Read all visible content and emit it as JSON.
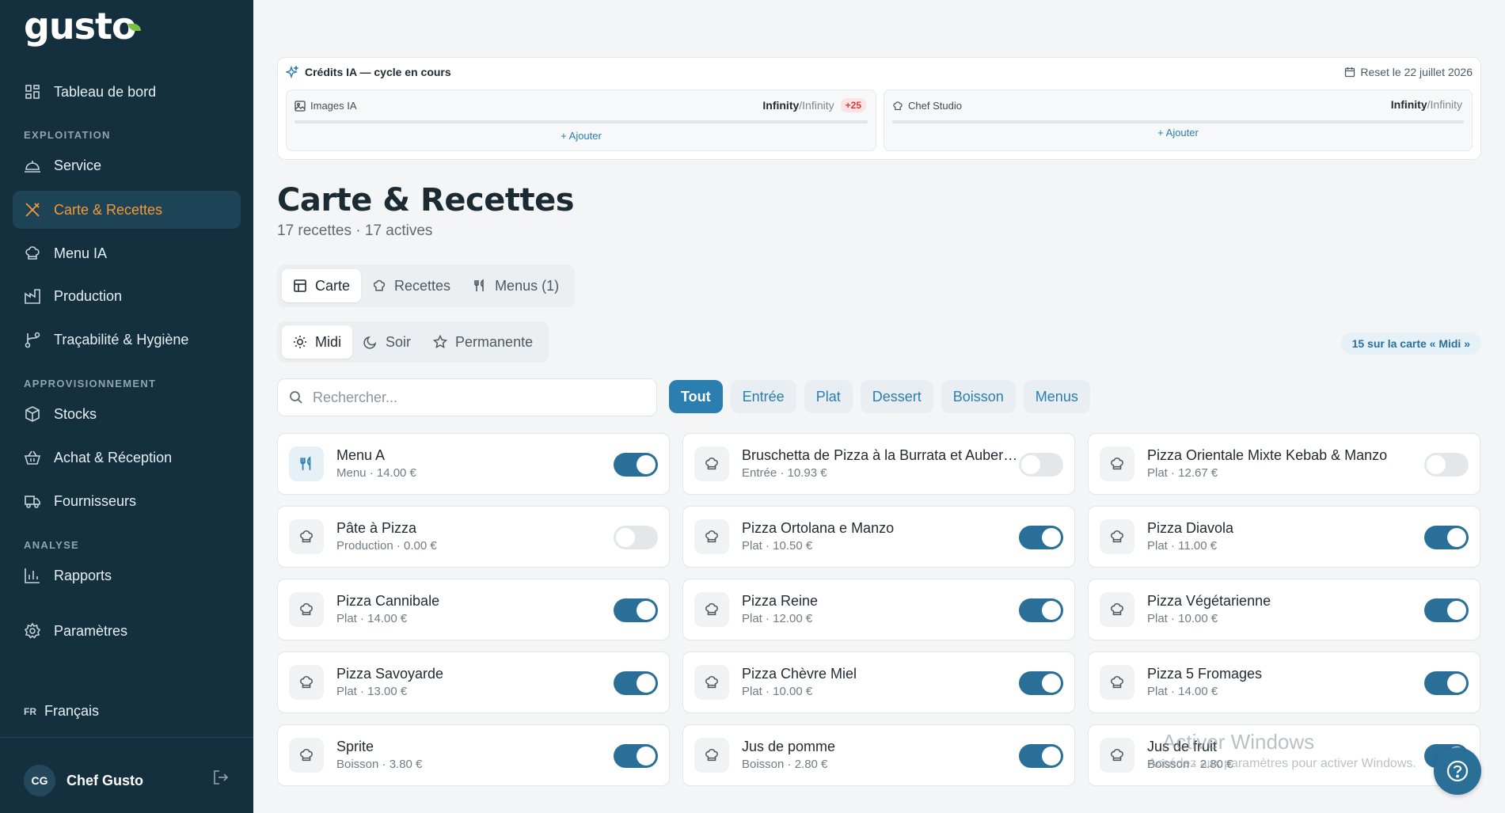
{
  "sidebar": {
    "logo": "gusto",
    "items": {
      "dashboard": "Tableau de bord",
      "service": "Service",
      "carte": "Carte & Recettes",
      "menu_ia": "Menu IA",
      "production": "Production",
      "tracabilite": "Traçabilité & Hygiène",
      "stocks": "Stocks",
      "achat": "Achat & Réception",
      "fournisseurs": "Fournisseurs",
      "rapports": "Rapports",
      "parametres": "Paramètres"
    },
    "sections": {
      "exploitation": "EXPLOITATION",
      "approvisionnement": "APPROVISIONNEMENT",
      "analyse": "ANALYSE"
    },
    "lang_code": "FR",
    "lang_label": "Français",
    "user_initials": "CG",
    "user_name": "Chef Gusto"
  },
  "credits": {
    "title": "Crédits IA — cycle en cours",
    "reset": "Reset le 22 juillet 2026",
    "boxes": [
      {
        "name": "Images IA",
        "used": "Infinity",
        "total": "/Infinity",
        "bonus": "+25",
        "add": "+ Ajouter"
      },
      {
        "name": "Chef Studio",
        "used": "Infinity",
        "total": "/Infinity",
        "add": "+ Ajouter"
      }
    ]
  },
  "page": {
    "title": "Carte & Recettes",
    "subtitle": "17 recettes · 17 actives"
  },
  "tabs": {
    "carte": "Carte",
    "recettes": "Recettes",
    "menus": "Menus (1)"
  },
  "services": {
    "midi": "Midi",
    "soir": "Soir",
    "permanente": "Permanente",
    "count_pill": "15 sur la carte « Midi »"
  },
  "search": {
    "placeholder": "Rechercher..."
  },
  "filters": {
    "tout": "Tout",
    "entree": "Entrée",
    "plat": "Plat",
    "dessert": "Dessert",
    "boisson": "Boisson",
    "menus": "Menus"
  },
  "items": [
    {
      "name": "Menu A",
      "meta": "Menu · 14.00 €",
      "active": true,
      "icon": "utensils-icon"
    },
    {
      "name": "Bruschetta de Pizza à la Burrata et Aubergine",
      "meta": "Entrée · 10.93 €",
      "active": false,
      "icon": "chef-hat-icon"
    },
    {
      "name": "Pizza Orientale Mixte Kebab & Manzo",
      "meta": "Plat · 12.67 €",
      "active": false,
      "icon": "chef-hat-icon"
    },
    {
      "name": "Pâte à Pizza",
      "meta": "Production · 0.00 €",
      "active": false,
      "icon": "chef-hat-icon"
    },
    {
      "name": "Pizza Ortolana e Manzo",
      "meta": "Plat · 10.50 €",
      "active": true,
      "icon": "chef-hat-icon"
    },
    {
      "name": "Pizza Diavola",
      "meta": "Plat · 11.00 €",
      "active": true,
      "icon": "chef-hat-icon"
    },
    {
      "name": "Pizza Cannibale",
      "meta": "Plat · 14.00 €",
      "active": true,
      "icon": "chef-hat-icon"
    },
    {
      "name": "Pizza Reine",
      "meta": "Plat · 12.00 €",
      "active": true,
      "icon": "chef-hat-icon"
    },
    {
      "name": "Pizza Végétarienne",
      "meta": "Plat · 10.00 €",
      "active": true,
      "icon": "chef-hat-icon"
    },
    {
      "name": "Pizza Savoyarde",
      "meta": "Plat · 13.00 €",
      "active": true,
      "icon": "chef-hat-icon"
    },
    {
      "name": "Pizza Chèvre Miel",
      "meta": "Plat · 10.00 €",
      "active": true,
      "icon": "chef-hat-icon"
    },
    {
      "name": "Pizza 5 Fromages",
      "meta": "Plat · 14.00 €",
      "active": true,
      "icon": "chef-hat-icon"
    },
    {
      "name": "Sprite",
      "meta": "Boisson · 3.80 €",
      "active": true,
      "icon": "chef-hat-icon"
    },
    {
      "name": "Jus de pomme",
      "meta": "Boisson · 2.80 €",
      "active": true,
      "icon": "chef-hat-icon"
    },
    {
      "name": "Jus de fruit",
      "meta": "Boisson · 2.80 €",
      "active": true,
      "icon": "chef-hat-icon"
    }
  ],
  "watermark": {
    "line1": "Activer Windows",
    "line2": "Accédez aux paramètres pour activer Windows."
  },
  "colors": {
    "sidebar": "#14303f",
    "accent": "#2a6f98",
    "active_nav": "#f29a35"
  }
}
